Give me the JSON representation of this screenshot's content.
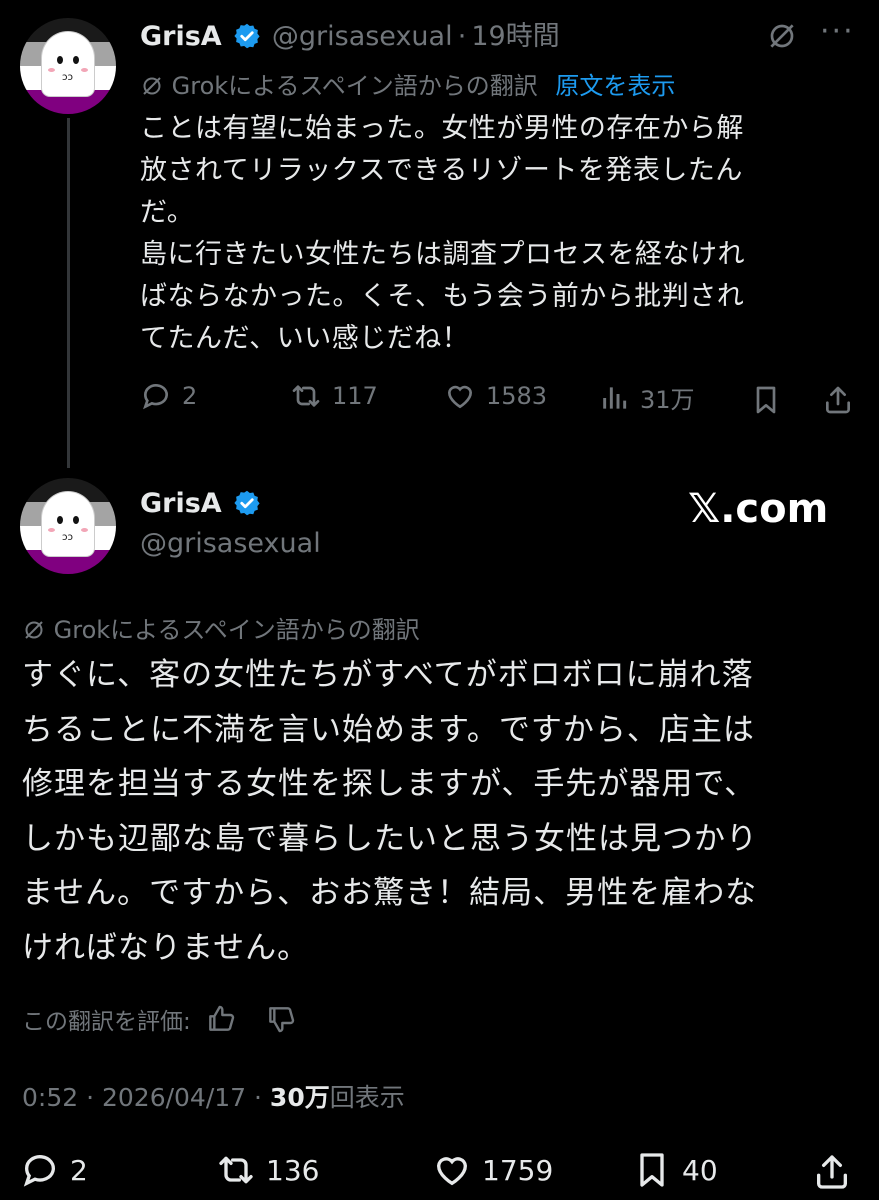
{
  "tweet1": {
    "display_name": "GrisA",
    "handle": "@grisasexual",
    "separator": "·",
    "time": "19時間",
    "translation_note": "Grokによるスペイン語からの翻訳",
    "show_original": "原文を表示",
    "text_lines": [
      "ことは有望に始まった。女性が男性の存在から解",
      "放されてリラックスできるリゾートを発表したん",
      "だ。",
      "島に行きたい女性たちは調査プロセスを経なけれ",
      "ばならなかった。くそ、もう会う前から批判され",
      "てたんだ、いい感じだね！"
    ],
    "replies": "2",
    "reposts": "117",
    "likes": "1583",
    "views": "31万"
  },
  "tweet2": {
    "display_name": "GrisA",
    "handle": "@grisasexual",
    "brand": "𝕏.com",
    "translation_note": "Grokによるスペイン語からの翻訳",
    "text_lines": [
      "すぐに、客の女性たちがすべてがボロボロに崩れ落",
      "ちることに不満を言い始めます。ですから、店主は",
      "修理を担当する女性を探しますが、手先が器用で、",
      "しかも辺鄙な島で暮らしたいと思う女性は見つかり",
      "ません。ですから、おお驚き！結局、男性を雇わな",
      "ければなりません。"
    ],
    "rate_translation": "この翻訳を評価:",
    "timestamp": "0:52 · 2026/04/17 · ",
    "views_count": "30万",
    "views_label": "回表示",
    "replies": "2",
    "reposts": "136",
    "likes": "1759",
    "bookmarks": "40"
  },
  "colors": {
    "background": "#000000",
    "text": "#e7e9ea",
    "muted": "#71767b",
    "link": "#1d9bf0",
    "verified": "#1d9bf0",
    "flag_gray": "#a4a4a4",
    "flag_purple": "#800080"
  },
  "icons": [
    "grok-icon",
    "more-icon",
    "reply-icon",
    "repost-icon",
    "like-icon",
    "views-icon",
    "bookmark-icon",
    "share-icon",
    "thumbs-up-icon",
    "thumbs-down-icon",
    "verified-icon"
  ]
}
